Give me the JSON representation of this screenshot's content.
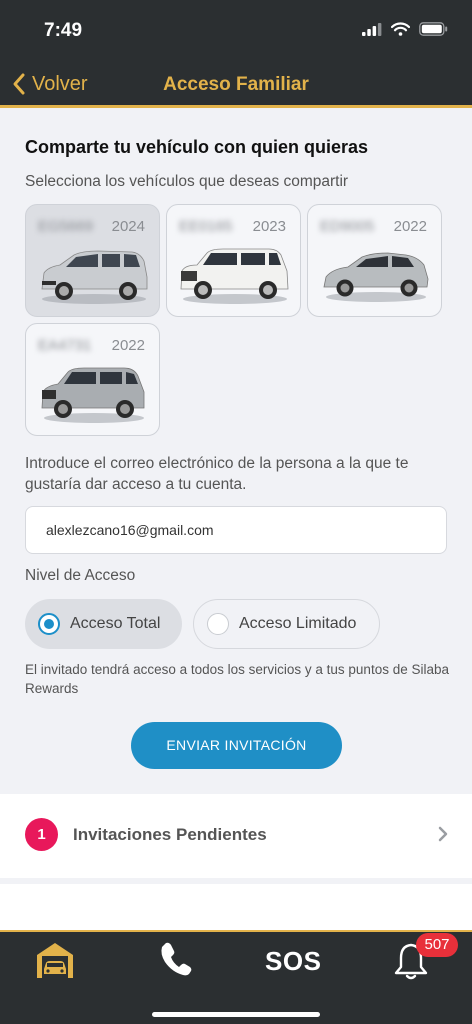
{
  "status_bar": {
    "time": "7:49"
  },
  "nav": {
    "back_label": "Volver",
    "title": "Acceso Familiar"
  },
  "share": {
    "title": "Comparte tu vehículo con quien quieras",
    "subtitle": "Selecciona los vehículos que deseas compartir",
    "vehicles": [
      {
        "plate": "EG5669",
        "year": "2024",
        "selected": true,
        "body_color": "#c9ccd0",
        "type": "minivan"
      },
      {
        "plate": "EE0165",
        "year": "2023",
        "selected": false,
        "body_color": "#f2f2f0",
        "type": "suv"
      },
      {
        "plate": "ED9005",
        "year": "2022",
        "selected": false,
        "body_color": "#b8bcbf",
        "type": "crossover"
      },
      {
        "plate": "EA4731",
        "year": "2022",
        "selected": false,
        "body_color": "#a9adb1",
        "type": "suv-compact"
      }
    ]
  },
  "email": {
    "label": "Introduce el correo electrónico de la persona a la que te gustaría dar acceso a tu cuenta.",
    "value": "alexlezcano16@gmail.com"
  },
  "access": {
    "label": "Nivel de Acceso",
    "options": [
      {
        "label": "Acceso Total",
        "selected": true
      },
      {
        "label": "Acceso Limitado",
        "selected": false
      }
    ],
    "description": "El invitado tendrá acceso a todos los servicios y a tus puntos de Silaba Rewards"
  },
  "send_button": {
    "label": "ENVIAR INVITACIÓN"
  },
  "pending": {
    "count": "1",
    "label": "Invitaciones Pendientes"
  },
  "tab_bar": {
    "sos_label": "SOS",
    "notifications_count": "507"
  },
  "colors": {
    "accent_gold": "#e2b24a",
    "primary_blue": "#1f8fc6",
    "badge_red": "#e8185b",
    "bar_dark": "#2b2f31"
  },
  "icons": [
    "signal-icon",
    "wifi-icon",
    "battery-icon",
    "back-chevron-icon",
    "chevron-right-icon",
    "garage-car-icon",
    "phone-icon",
    "bell-icon"
  ]
}
